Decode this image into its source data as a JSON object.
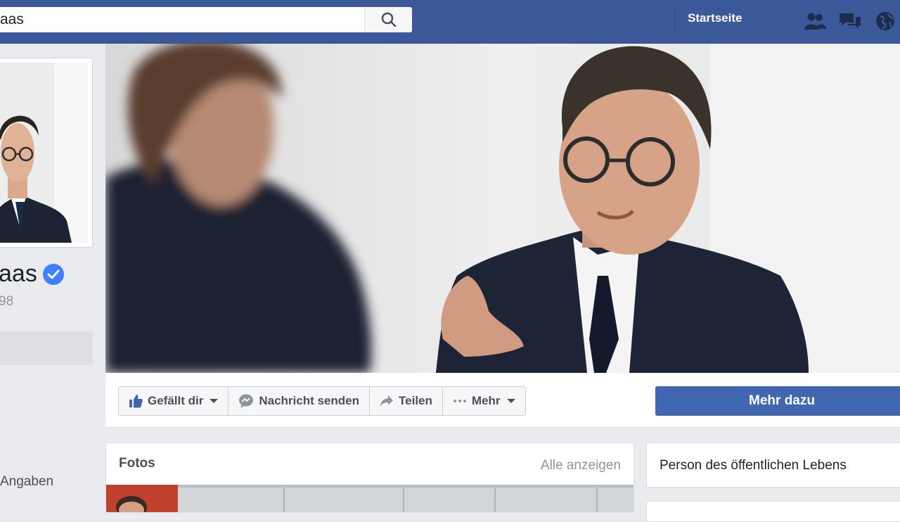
{
  "search": {
    "value": "aas"
  },
  "nav": {
    "home_label": "Startseite"
  },
  "profile": {
    "name": "aas",
    "handle": "98"
  },
  "left_nav": {
    "angaben_label": "Angaben"
  },
  "actions": {
    "like_label": "Gefällt dir",
    "message_label": "Nachricht senden",
    "share_label": "Teilen",
    "more_label": "Mehr",
    "cta_label": "Mehr dazu"
  },
  "photos": {
    "title": "Fotos",
    "show_all_label": "Alle anzeigen"
  },
  "category": {
    "label": "Person des öffentlichen Lebens"
  },
  "colors": {
    "brand": "#3b5998",
    "cta": "#4267b2",
    "verified": "#4080ff"
  },
  "icons": [
    "search-icon",
    "friends-icon",
    "messages-icon",
    "globe-icon",
    "verified-badge-icon",
    "thumbs-up-icon",
    "message-bubble-icon",
    "share-arrow-icon",
    "more-dots-icon",
    "caret-down-icon"
  ]
}
